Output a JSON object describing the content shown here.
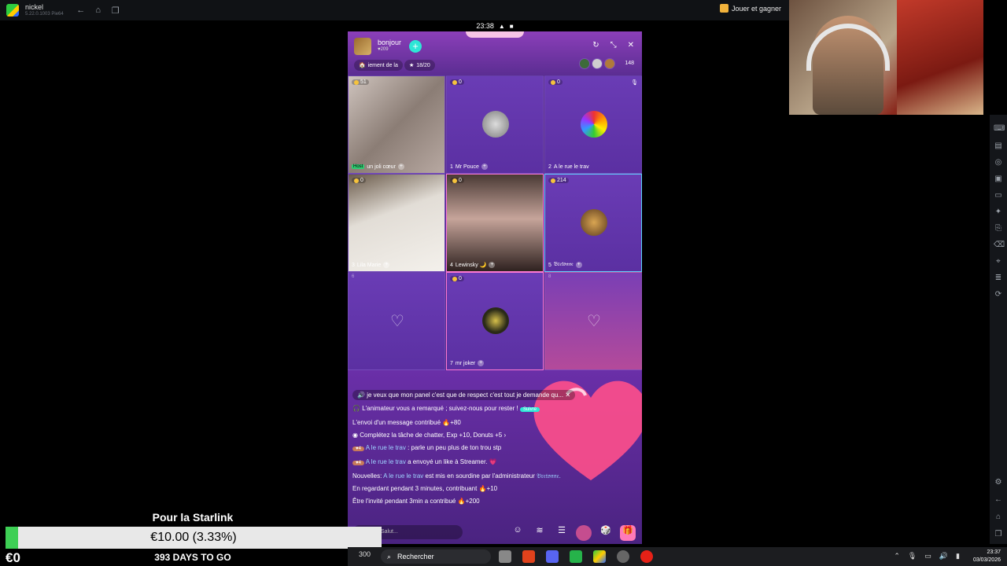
{
  "emulator": {
    "title": "nickel",
    "subtitle": "5.22.0.1003 Pie64",
    "promo_label": "Jouer et gagner"
  },
  "phone": {
    "status_time": "23:38",
    "room": {
      "name": "bonjour",
      "count": "209",
      "chip_left": "iement de la",
      "chip_right": "18/20",
      "viewers": "148"
    },
    "seats": [
      {
        "coins": "51",
        "label": "un joli cœur",
        "host": "Host"
      },
      {
        "coins": "0",
        "label": "Mr Pouce",
        "num": "1"
      },
      {
        "coins": "0",
        "label": "A le rue le trav",
        "num": "2"
      },
      {
        "coins": "0",
        "label": "Lila Marie",
        "num": "3"
      },
      {
        "coins": "0",
        "label": "Lewinsky 🌙",
        "num": "4"
      },
      {
        "coins": "214",
        "label": "𝔅𝔯𝔢𝔱𝔬𝔫𝔫𝔢",
        "num": "5"
      },
      {
        "num": "6"
      },
      {
        "coins": "0",
        "label": "mr joker",
        "num": "7"
      },
      {
        "num": "8"
      }
    ],
    "chat": {
      "pinned": "je veux que mon panel c'est que de respect c'est tout je demande qu...",
      "notice": "L'animateur vous a remarqué ; suivez-nous pour rester !",
      "notice_btn": "Suivre",
      "m1": "L'envoi d'un message contribué",
      "m1_val": "+80",
      "m2": "Complétez la tâche de chatter, Exp +10, Donuts +5",
      "m3_user": "A le rue le trav",
      "m3_text": ": parle un peu plus de ton trou stp",
      "m4_user": "A le rue le trav",
      "m4_text": "a envoyé un like à Streamer.",
      "m5_prefix": "Nouvelles:",
      "m5_user": "A le rue le trav",
      "m5_text": "est mis en sourdine par l'administrateur",
      "m5_admin": "𝔅𝔯𝔢𝔱𝔬𝔫𝔫𝔢.",
      "m6": "En regardant pendant 3 minutes, contribuant",
      "m6_val": "+10",
      "m7": "Être l'invité pendant 3min a contribué",
      "m7_val": "+200",
      "badge_lvl": "4",
      "input_placeholder": "Salut..."
    }
  },
  "overlay": {
    "goal_title": "Pour la Starlink",
    "goal_text": "€10.00 (3.33%)",
    "goal_fraction": 0.0333,
    "goal_left": "€0",
    "goal_days": "393 DAYS TO GO"
  },
  "taskbar": {
    "search_label": "Rechercher",
    "widget": "300",
    "time": "23:37",
    "date": "03/03/2026"
  }
}
